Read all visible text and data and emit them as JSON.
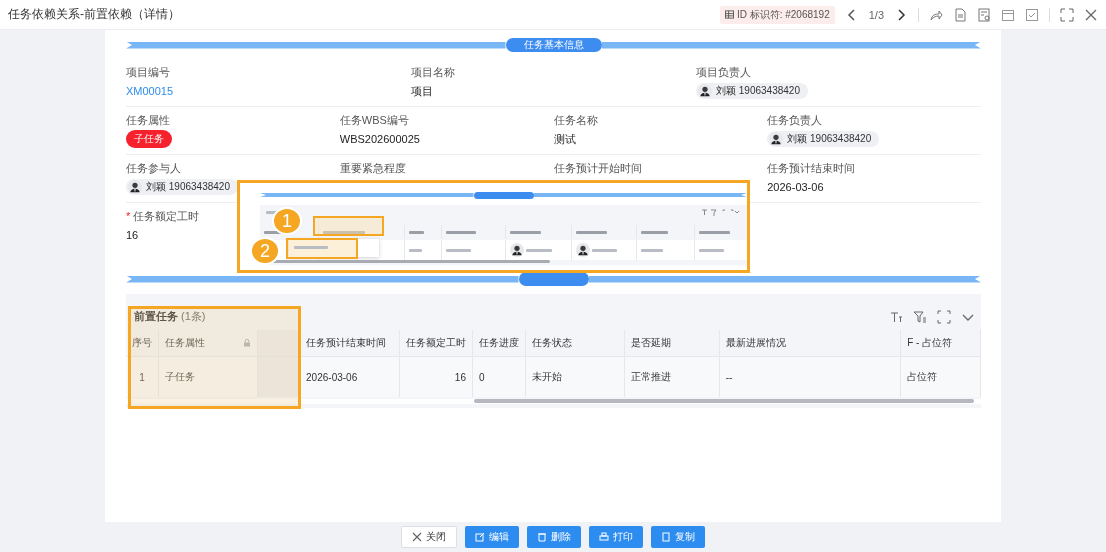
{
  "window": {
    "title": "任务依赖关系-前置依赖（详情）"
  },
  "toolbar": {
    "id_label": "ID 标识符: #2068192",
    "pager": "1/3"
  },
  "section_basic": {
    "title": "任务基本信息"
  },
  "field_rows": [
    [
      {
        "label": "项目编号",
        "kind": "link",
        "value": "XM00015",
        "required": false
      },
      {
        "label": "项目名称",
        "kind": "text",
        "value": "项目",
        "required": false
      },
      {
        "label": "项目负责人",
        "kind": "person",
        "value": "刘颖 19063438420",
        "required": false
      }
    ],
    [
      {
        "label": "任务属性",
        "kind": "tag",
        "value": "子任务",
        "required": false
      },
      {
        "label": "任务WBS编号",
        "kind": "text",
        "value": "WBS202600025",
        "required": false
      },
      {
        "label": "任务名称",
        "kind": "text",
        "value": "测试",
        "required": false
      },
      {
        "label": "任务负责人",
        "kind": "person",
        "value": "刘颖 19063438420",
        "required": false
      }
    ],
    [
      {
        "label": "任务参与人",
        "kind": "person",
        "value": "刘颖 19063438420",
        "required": false
      },
      {
        "label": "重要紧急程度",
        "kind": "text",
        "required": false
      },
      {
        "label": "任务预计开始时间",
        "kind": "text",
        "required": false
      },
      {
        "label": "任务预计结束时间",
        "kind": "text",
        "value": "2026-03-06",
        "required": false
      }
    ],
    [
      {
        "label": "任务额定工时",
        "kind": "text",
        "value": "16",
        "required": true
      }
    ]
  ],
  "required_marker": "*",
  "inset": {
    "callouts": [
      "1",
      "2"
    ]
  },
  "predecessors": {
    "title": "前置任务",
    "count": "(1条)",
    "columns": [
      {
        "label": "序号",
        "kind": "text"
      },
      {
        "label": "任务属性",
        "kind": "locked"
      },
      {
        "label": "任务预计结束时间",
        "kind": "text"
      },
      {
        "label": "任务额定工时",
        "kind": "number"
      },
      {
        "label": "任务进度",
        "kind": "text"
      },
      {
        "label": "任务状态",
        "kind": "text"
      },
      {
        "label": "是否延期",
        "kind": "text"
      },
      {
        "label": "最新进展情况",
        "kind": "text"
      },
      {
        "label": "F - 占位符",
        "kind": "text"
      }
    ],
    "rows": [
      [
        "1",
        "子任务",
        "2026-03-06",
        "16",
        "0",
        "未开始",
        "正常推进",
        "--",
        "占位符"
      ]
    ]
  },
  "buttons": [
    {
      "label": "关闭",
      "kind": "close"
    },
    {
      "label": "编辑",
      "kind": "edit"
    },
    {
      "label": "删除",
      "kind": "delete"
    },
    {
      "label": "打印",
      "kind": "print"
    },
    {
      "label": "复制",
      "kind": "copy"
    }
  ]
}
